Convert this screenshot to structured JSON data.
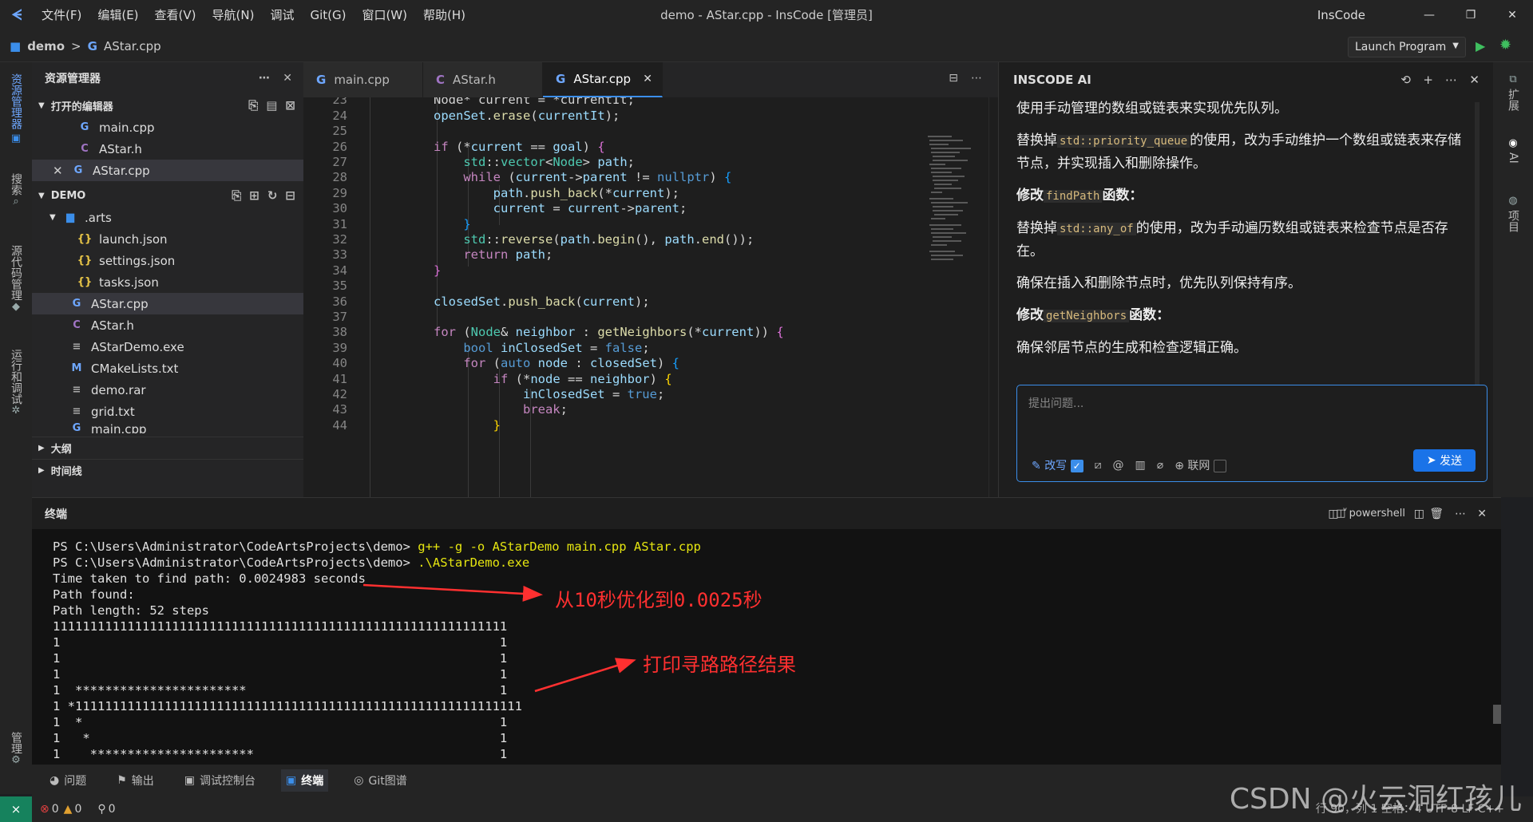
{
  "titlebar": {
    "menu": [
      "文件(F)",
      "编辑(E)",
      "查看(V)",
      "导航(N)",
      "调试",
      "Git(G)",
      "窗口(W)",
      "帮助(H)"
    ],
    "window_title": "demo - AStar.cpp - InsCode [管理员]",
    "brand": "InsCode"
  },
  "breadcrumb": {
    "project": "demo",
    "sep": ">",
    "file": "AStar.cpp"
  },
  "run": {
    "config": "Launch Program"
  },
  "activity": {
    "explorer": "资源管理器",
    "search": "搜索",
    "scm": "源代码管理",
    "debug": "运行和调试",
    "manage": "管理"
  },
  "explorer": {
    "title": "资源管理器",
    "open_editors_label": "打开的编辑器",
    "open_editors": [
      {
        "name": "main.cpp",
        "icon": "G"
      },
      {
        "name": "AStar.h",
        "icon": "C"
      },
      {
        "name": "AStar.cpp",
        "icon": "G"
      }
    ],
    "project_label": "DEMO",
    "folder": ".arts",
    "folder_files": [
      "launch.json",
      "settings.json",
      "tasks.json"
    ],
    "files": [
      {
        "name": "AStar.cpp",
        "icon": "G"
      },
      {
        "name": "AStar.h",
        "icon": "C"
      },
      {
        "name": "AStarDemo.exe",
        "icon": "≡"
      },
      {
        "name": "CMakeLists.txt",
        "icon": "M"
      },
      {
        "name": "demo.rar",
        "icon": "≡"
      },
      {
        "name": "grid.txt",
        "icon": "≡"
      },
      {
        "name": "main.cpp",
        "icon": "G"
      }
    ],
    "outline_label": "大纲",
    "timeline_label": "时间线"
  },
  "editor": {
    "tabs": [
      "main.cpp",
      "AStar.h",
      "AStar.cpp"
    ],
    "line_numbers": [
      "23",
      "24",
      "25",
      "26",
      "27",
      "28",
      "29",
      "30",
      "31",
      "32",
      "33",
      "34",
      "35",
      "36",
      "37",
      "38",
      "39",
      "40",
      "41",
      "42",
      "43",
      "44"
    ]
  },
  "ai": {
    "title": "INSCODE AI",
    "p1": "使用手动管理的数组或链表来实现优先队列。",
    "p2a": "替换掉",
    "p2code": "std::priority_queue",
    "p2b": "的使用，改为手动维护一个数组或链表来存储节点，并实现插入和删除操作。",
    "p3a": "修改",
    "p3code": "findPath",
    "p3b": "函数：",
    "p4a": "替换掉",
    "p4code": "std::any_of",
    "p4b": "的使用，改为手动遍历数组或链表来检查节点是否存在。",
    "p5": "确保在插入和删除节点时，优先队列保持有序。",
    "p6a": "修改",
    "p6code": "getNeighbors",
    "p6b": "函数：",
    "p7": "确保邻居节点的生成和检查逻辑正确。",
    "input_placeholder": "提出问题...",
    "rewrite": "改写",
    "web": "联网",
    "send": "发送"
  },
  "rightbar": {
    "ext": "扩展",
    "ai": "AI",
    "project": "项目"
  },
  "terminal": {
    "title": "终端",
    "shell": "powershell",
    "prompt1": "PS C:\\Users\\Administrator\\CodeArtsProjects\\demo> ",
    "cmd1": "g++ -g -o AStarDemo main.cpp AStar.cpp",
    "prompt2": "PS C:\\Users\\Administrator\\CodeArtsProjects\\demo> ",
    "cmd2": ".\\AStarDemo.exe",
    "out": [
      "Time taken to find path: 0.0024983 seconds",
      "Path found:",
      "Path length: 52 steps",
      "1111111111111111111111111111111111111111111111111111111111111",
      "1                                                           1",
      "1                                                           1",
      "1                                                           1",
      "1  ***********************                                  1",
      "1 *111111111111111111111111111111111111111111111111111111111111",
      "1  *                                                        1",
      "1   *                                                       1",
      "1    **********************                                 1"
    ],
    "annot1": "从10秒优化到0.0025秒",
    "annot2": "打印寻路路径结果"
  },
  "panel_tabs": [
    "问题",
    "输出",
    "调试控制台",
    "终端",
    "Git图谱"
  ],
  "status": {
    "errors": "0",
    "warnings": "0",
    "ports": "0",
    "right": "行 90，列 1   空格：4   UTF-8   LF   C++"
  },
  "watermark": "CSDN @火云洞红孩儿",
  "colors": {
    "accent": "#3b8eea",
    "remote": "#16825d",
    "annotation": "#ff3030"
  }
}
